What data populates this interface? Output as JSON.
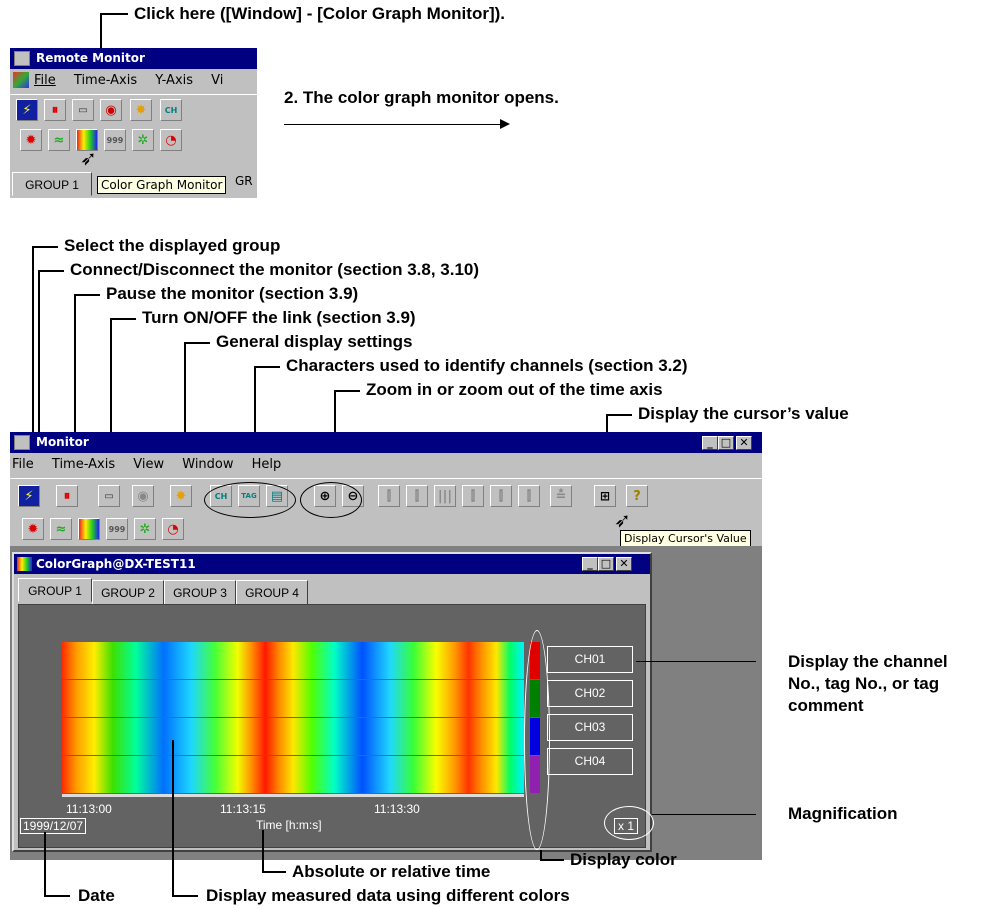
{
  "callouts": {
    "click_here": "Click here ([Window] - [Color Graph Monitor]).",
    "opens": "2. The color graph monitor opens.",
    "select_group": "Select the displayed group",
    "connect": "Connect/Disconnect the monitor (section 3.8, 3.10)",
    "pause": "Pause the monitor (section 3.9)",
    "link": "Turn ON/OFF the link (section 3.9)",
    "general": "General display settings",
    "characters": "Characters used to identify channels (section 3.2)",
    "zoom": "Zoom in or zoom out of the time axis",
    "cursor_value": "Display the cursor’s value",
    "channel_display_1": "Display the channel",
    "channel_display_2": "No., tag No., or tag",
    "channel_display_3": "comment",
    "magnification": "Magnification",
    "display_color": "Display color",
    "abs_rel_time": "Absolute or relative time",
    "date": "Date",
    "measured_data": "Display measured data using different colors"
  },
  "small_window": {
    "title": "Remote Monitor",
    "menu": [
      "File",
      "Time-Axis",
      "Y-Axis",
      "Vi"
    ],
    "tab": "GROUP 1",
    "tab_partial": "GR",
    "tooltip": "Color Graph Monitor"
  },
  "monitor": {
    "title": "Monitor",
    "menu": [
      "File",
      "Time-Axis",
      "View",
      "Window",
      "Help"
    ],
    "tooltip": "Display Cursor's Value",
    "child_title": "ColorGraph@DX-TEST11",
    "tabs": [
      "GROUP 1",
      "GROUP 2",
      "GROUP 3",
      "GROUP 4"
    ],
    "channels": [
      {
        "label": "CH01",
        "color": "#e00000"
      },
      {
        "label": "CH02",
        "color": "#008000"
      },
      {
        "label": "CH03",
        "color": "#0000e0"
      },
      {
        "label": "CH04",
        "color": "#9020b0"
      }
    ],
    "time_ticks": [
      "11:13:00",
      "11:13:15",
      "11:13:30"
    ],
    "date": "1999/12/07",
    "axis_label": "Time [h:m:s]",
    "magnification": "x 1",
    "toolbar_labels": {
      "ch": "CH",
      "tag": "TAG",
      "num": "999"
    }
  }
}
